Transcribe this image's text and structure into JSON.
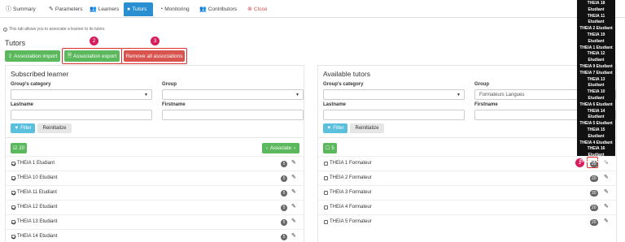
{
  "tabs": [
    {
      "label": "Summary",
      "icon": "info-icon"
    },
    {
      "label": "Parameters",
      "icon": "edit-icon"
    },
    {
      "label": "Learners",
      "icon": "users-icon"
    },
    {
      "label": "Tutors",
      "icon": "user-icon",
      "active": true
    },
    {
      "label": "Monitoring",
      "icon": "gauge-icon"
    },
    {
      "label": "Contributors",
      "icon": "users-icon"
    },
    {
      "label": "Close",
      "icon": "close-icon"
    }
  ],
  "info_text": "This tab allows you to associate a learner to its tutors",
  "page_title": "Tutors",
  "actions": {
    "import_label": "Association import",
    "export_label": "Association export",
    "remove_all_label": "Remove all associations"
  },
  "callouts": [
    "2",
    "3",
    "1"
  ],
  "left": {
    "title": "Subscribed learner",
    "group_category_label": "Group's category",
    "group_category_value": "",
    "group_label": "Group",
    "group_value": "",
    "lastname_label": "Lastname",
    "firstname_label": "Firstname",
    "filter_label": "Filter",
    "reinit_label": "Reinitialize",
    "count": "20",
    "associate_label": "Associate",
    "rows": [
      {
        "name": "THEIA 1 Etudiant",
        "count": "5"
      },
      {
        "name": "THEIA 10 Etudiant",
        "count": "5"
      },
      {
        "name": "THEIA 11 Etudiant",
        "count": "5"
      },
      {
        "name": "THEIA 12 Etudiant",
        "count": "5"
      },
      {
        "name": "THEIA 13 Etudiant",
        "count": "5"
      },
      {
        "name": "THEIA 14 Etudiant",
        "count": "5"
      }
    ]
  },
  "right": {
    "title": "Available tutors",
    "group_category_label": "Group's category",
    "group_category_value": "",
    "group_label": "Group",
    "group_value": "Formateurs Langues",
    "lastname_label": "Lastname",
    "firstname_label": "Firstname",
    "filter_label": "Filter",
    "reinit_label": "Reinitialize",
    "count": "5",
    "rows": [
      {
        "name": "THEIA 1 Formateur",
        "count": "20"
      },
      {
        "name": "THEIA 2 Formateur",
        "count": "20"
      },
      {
        "name": "THEIA 3 Formateur",
        "count": "20"
      },
      {
        "name": "THEIA 4 Formateur",
        "count": "20"
      },
      {
        "name": "THEIA 5 Formateur",
        "count": "20"
      }
    ]
  },
  "tooltip_lines": [
    "THEIA 18",
    "Etudiant",
    "THEIA 11",
    "Etudiant",
    "THEIA 2 Etudiant",
    "THEIA 19",
    "Etudiant",
    "THEIA 1 Etudiant",
    "THEIA 12",
    "Etudiant",
    "THEIA 9 Etudiant",
    "THEIA 7 Etudiant",
    "THEIA 13",
    "Etudiant",
    "THEIA 10",
    "Etudiant",
    "THEIA 6 Etudiant",
    "THEIA 14",
    "Etudiant",
    "THEIA 5 Etudiant",
    "THEIA 15",
    "Etudiant",
    "THEIA 4 Etudiant",
    "THEIA 16",
    "Etudiant",
    "THEIA 3 Etudiant"
  ],
  "colors": {
    "accent": "#2a8fd1",
    "success": "#5cb85c",
    "danger": "#d9534f",
    "info": "#5bc0de",
    "callout": "#d91c5c"
  }
}
